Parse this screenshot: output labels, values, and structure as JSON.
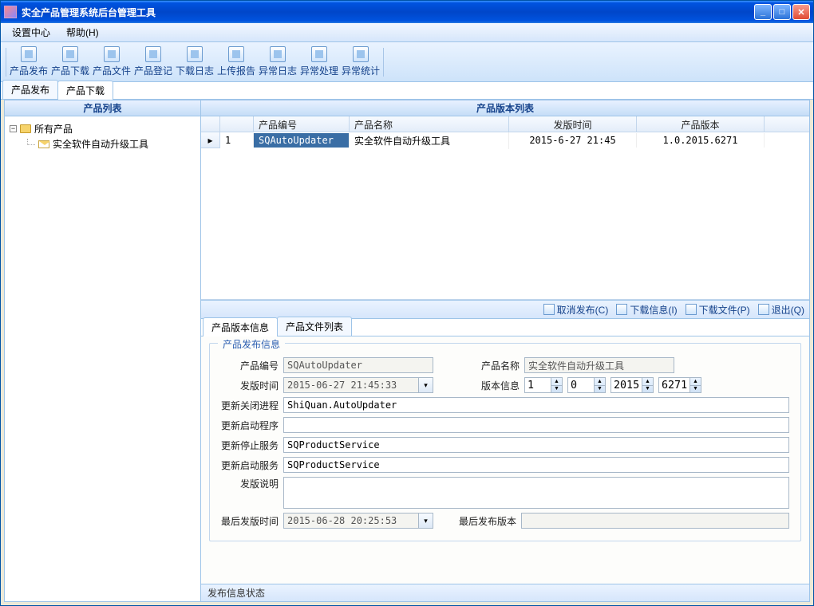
{
  "window": {
    "title": "实全产品管理系统后台管理工具"
  },
  "menu": {
    "settings": "设置中心",
    "help": "帮助(H)"
  },
  "toolbar": {
    "items": [
      "产品发布",
      "产品下载",
      "产品文件",
      "产品登记",
      "下载日志",
      "上传报告",
      "异常日志",
      "异常处理",
      "异常统计"
    ]
  },
  "subtabs": {
    "tab0": "产品发布",
    "tab1": "产品下载"
  },
  "leftpane": {
    "title": "产品列表",
    "root": "所有产品",
    "child0": "实全软件自动升级工具"
  },
  "grid": {
    "title": "产品版本列表",
    "headers": {
      "num": "",
      "code": "产品编号",
      "name": "产品名称",
      "time": "发版时间",
      "ver": "产品版本"
    },
    "rows": [
      {
        "num": "1",
        "code": "SQAutoUpdater",
        "name": "实全软件自动升级工具",
        "time": "2015-6-27 21:45",
        "ver": "1.0.2015.6271"
      }
    ]
  },
  "midbar": {
    "cancel": "取消发布(C)",
    "dlinfo": "下载信息(I)",
    "dlfile": "下载文件(P)",
    "exit": "退出(Q)"
  },
  "detailtabs": {
    "tab0": "产品版本信息",
    "tab1": "产品文件列表"
  },
  "detail": {
    "legend": "产品发布信息",
    "labels": {
      "code": "产品编号",
      "name": "产品名称",
      "pubtime": "发版时间",
      "verinfo": "版本信息",
      "closeproc": "更新关闭进程",
      "startprog": "更新启动程序",
      "stopsvc": "更新停止服务",
      "startsvc": "更新启动服务",
      "pubdesc": "发版说明",
      "lasttime": "最后发版时间",
      "lastver": "最后发布版本"
    },
    "values": {
      "code": "SQAutoUpdater",
      "name": "实全软件自动升级工具",
      "pubtime": "2015-06-27 21:45:33",
      "ver1": "1",
      "ver2": "0",
      "ver3": "2015",
      "ver4": "6271",
      "closeproc": "ShiQuan.AutoUpdater",
      "startprog": "",
      "stopsvc": "SQProductService",
      "startsvc": "SQProductService",
      "pubdesc": "",
      "lasttime": "2015-06-28 20:25:53",
      "lastver": ""
    }
  },
  "statusbar": {
    "text": "发布信息状态"
  }
}
